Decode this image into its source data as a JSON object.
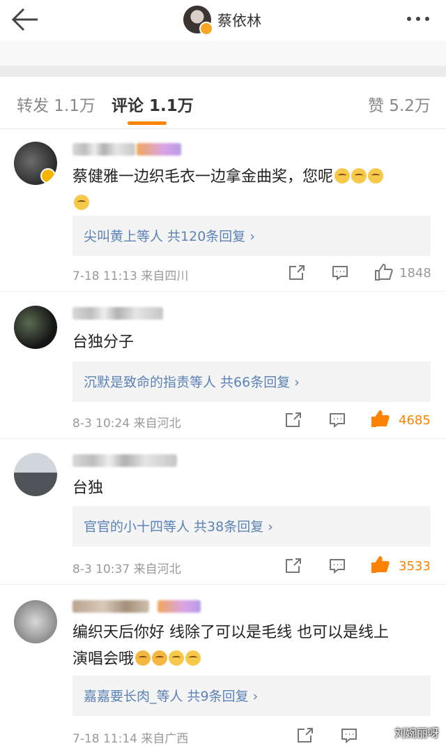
{
  "header": {
    "author_name": "蔡依林"
  },
  "tabs": {
    "repost": "转发 1.1万",
    "comments": "评论 1.1万",
    "likes": "赞 5.2万"
  },
  "comments": [
    {
      "text": "蔡健雅一边织毛衣一边拿金曲奖，您呢",
      "reply_summary": "尖叫黄上等人  共120条回复 ›",
      "time_location": "7-18 11:13  来自四川",
      "likes": "1848",
      "liked": false
    },
    {
      "text": "台独分子",
      "reply_summary": "沉默是致命的指责等人  共66条回复 ›",
      "time_location": "8-3 10:24  来自河北",
      "likes": "4685",
      "liked": true
    },
    {
      "text": "台独",
      "reply_summary": "官官的小十四等人  共38条回复 ›",
      "time_location": "8-3 10:37  来自河北",
      "likes": "3533",
      "liked": true
    },
    {
      "text_line1": "编织天后你好 线除了可以是毛线 也可以是线上",
      "text_line2": "演唱会哦",
      "reply_summary": "嘉嘉要长肉_等人  共9条回复 ›",
      "time_location": "7-18 11:14  来自广西"
    }
  ],
  "watermark": "刘婉丽呀",
  "colors": {
    "accent": "#ff8200",
    "link": "#5b82b6"
  }
}
